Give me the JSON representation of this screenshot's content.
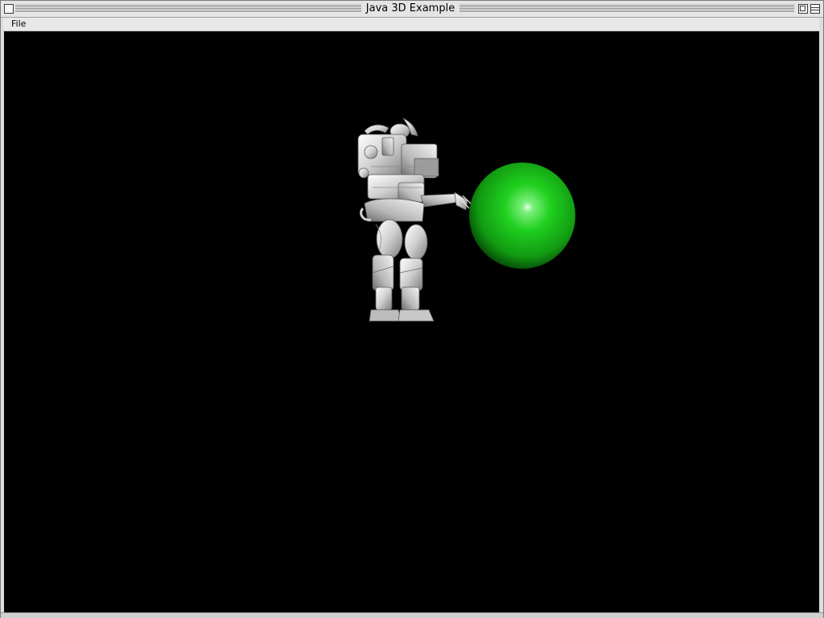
{
  "window": {
    "title": "Java 3D Example",
    "buttons": [
      "close-button",
      "zoom-button",
      "shade-button"
    ]
  },
  "menubar": {
    "items": [
      {
        "label": "File"
      }
    ]
  },
  "scene": {
    "background_color": "#000000",
    "robot_color": "#d9d9d9",
    "sphere_color": "#19c219"
  }
}
